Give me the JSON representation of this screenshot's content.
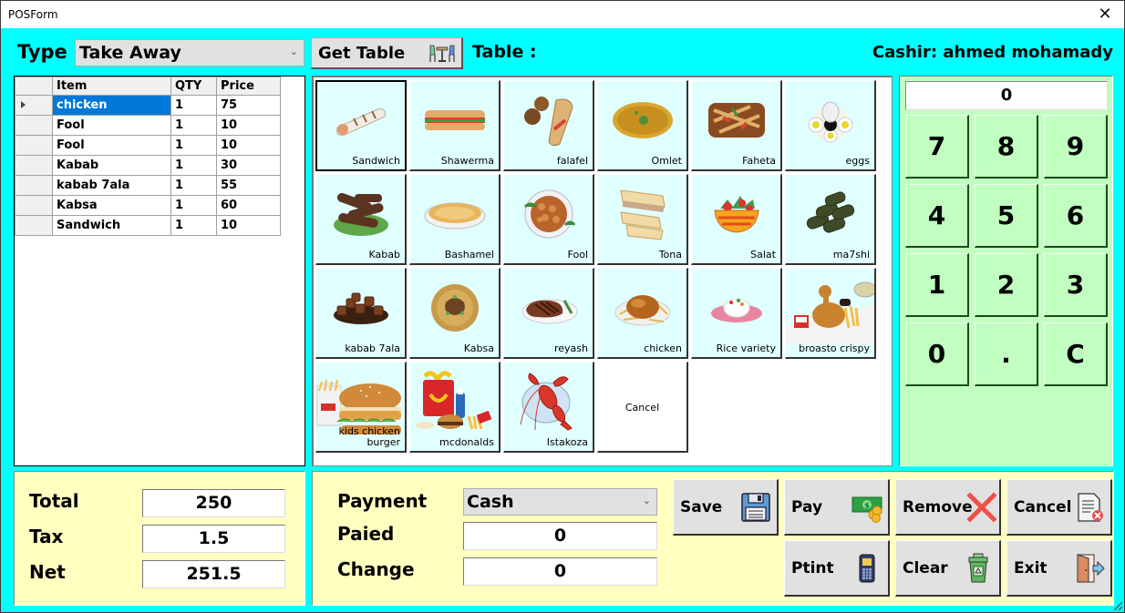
{
  "window": {
    "title": "POSForm",
    "close_icon": "close-icon"
  },
  "header": {
    "type_label": "Type",
    "type_value": "Take Away",
    "get_table_label": "Get Table",
    "get_table_icon": "dining-table-icon",
    "table_label": "Table :",
    "cashier_label": "Cashir: ahmed mohamady"
  },
  "order_grid": {
    "columns": [
      "Item",
      "QTY",
      "Price"
    ],
    "selected_row": 0,
    "rows": [
      {
        "item": "chicken",
        "qty": "1",
        "price": "75"
      },
      {
        "item": "Fool",
        "qty": "1",
        "price": "10"
      },
      {
        "item": "Fool",
        "qty": "1",
        "price": "10"
      },
      {
        "item": "Kabab",
        "qty": "1",
        "price": "30"
      },
      {
        "item": "kabab 7ala",
        "qty": "1",
        "price": "55"
      },
      {
        "item": "Kabsa",
        "qty": "1",
        "price": "60"
      },
      {
        "item": "Sandwich",
        "qty": "1",
        "price": "10"
      }
    ]
  },
  "menu": {
    "items": [
      {
        "label": "Sandwich",
        "icon": "wrap-sandwich-icon"
      },
      {
        "label": "Shawerma",
        "icon": "sub-sandwich-icon"
      },
      {
        "label": "falafel",
        "icon": "falafel-icon"
      },
      {
        "label": "Omlet",
        "icon": "omelet-icon"
      },
      {
        "label": "Faheta",
        "icon": "fajita-icon"
      },
      {
        "label": "eggs",
        "icon": "eggs-icon"
      },
      {
        "label": "Kabab",
        "icon": "kebab-icon"
      },
      {
        "label": "Bashamel",
        "icon": "bechamel-icon"
      },
      {
        "label": "Fool",
        "icon": "beans-icon"
      },
      {
        "label": "Tona",
        "icon": "tuna-sandwich-icon"
      },
      {
        "label": "Salat",
        "icon": "salad-bowl-icon"
      },
      {
        "label": "ma7shi",
        "icon": "stuffed-leaves-icon"
      },
      {
        "label": "kabab 7ala",
        "icon": "meat-cubes-icon"
      },
      {
        "label": "Kabsa",
        "icon": "kabsa-icon"
      },
      {
        "label": "reyash",
        "icon": "steak-icon"
      },
      {
        "label": "chicken",
        "icon": "roast-chicken-icon"
      },
      {
        "label": "Rice variety",
        "icon": "rice-plate-icon"
      },
      {
        "label": "broasto crispy",
        "icon": "fried-chicken-icon"
      },
      {
        "label": "kids chicken burger",
        "icon": "burger-meal-icon"
      },
      {
        "label": "mcdonalds",
        "icon": "happy-meal-icon"
      },
      {
        "label": "Istakoza",
        "icon": "lobster-icon"
      }
    ],
    "cancel_label": "Cancel"
  },
  "keypad": {
    "display": "0",
    "keys": [
      "7",
      "8",
      "9",
      "4",
      "5",
      "6",
      "1",
      "2",
      "3",
      "0",
      ".",
      "C"
    ]
  },
  "totals": {
    "total_label": "Total",
    "total_value": "250",
    "tax_label": "Tax",
    "tax_value": "1.5",
    "net_label": "Net",
    "net_value": "251.5"
  },
  "payment": {
    "payment_label": "Payment",
    "payment_method": "Cash",
    "paid_label": "Paied",
    "paid_value": "0",
    "change_label": "Change",
    "change_value": "0"
  },
  "actions": {
    "save": {
      "label": "Save",
      "icon": "floppy-disk-icon"
    },
    "pay": {
      "label": "Pay",
      "icon": "cash-coins-icon"
    },
    "remove": {
      "label": "Remove",
      "icon": "red-x-icon"
    },
    "cancel": {
      "label": "Cancel",
      "icon": "document-delete-icon"
    },
    "print": {
      "label": "Ptint",
      "icon": "card-terminal-icon"
    },
    "clear": {
      "label": "Clear",
      "icon": "recycle-bin-icon"
    },
    "exit": {
      "label": "Exit",
      "icon": "exit-door-icon"
    }
  }
}
